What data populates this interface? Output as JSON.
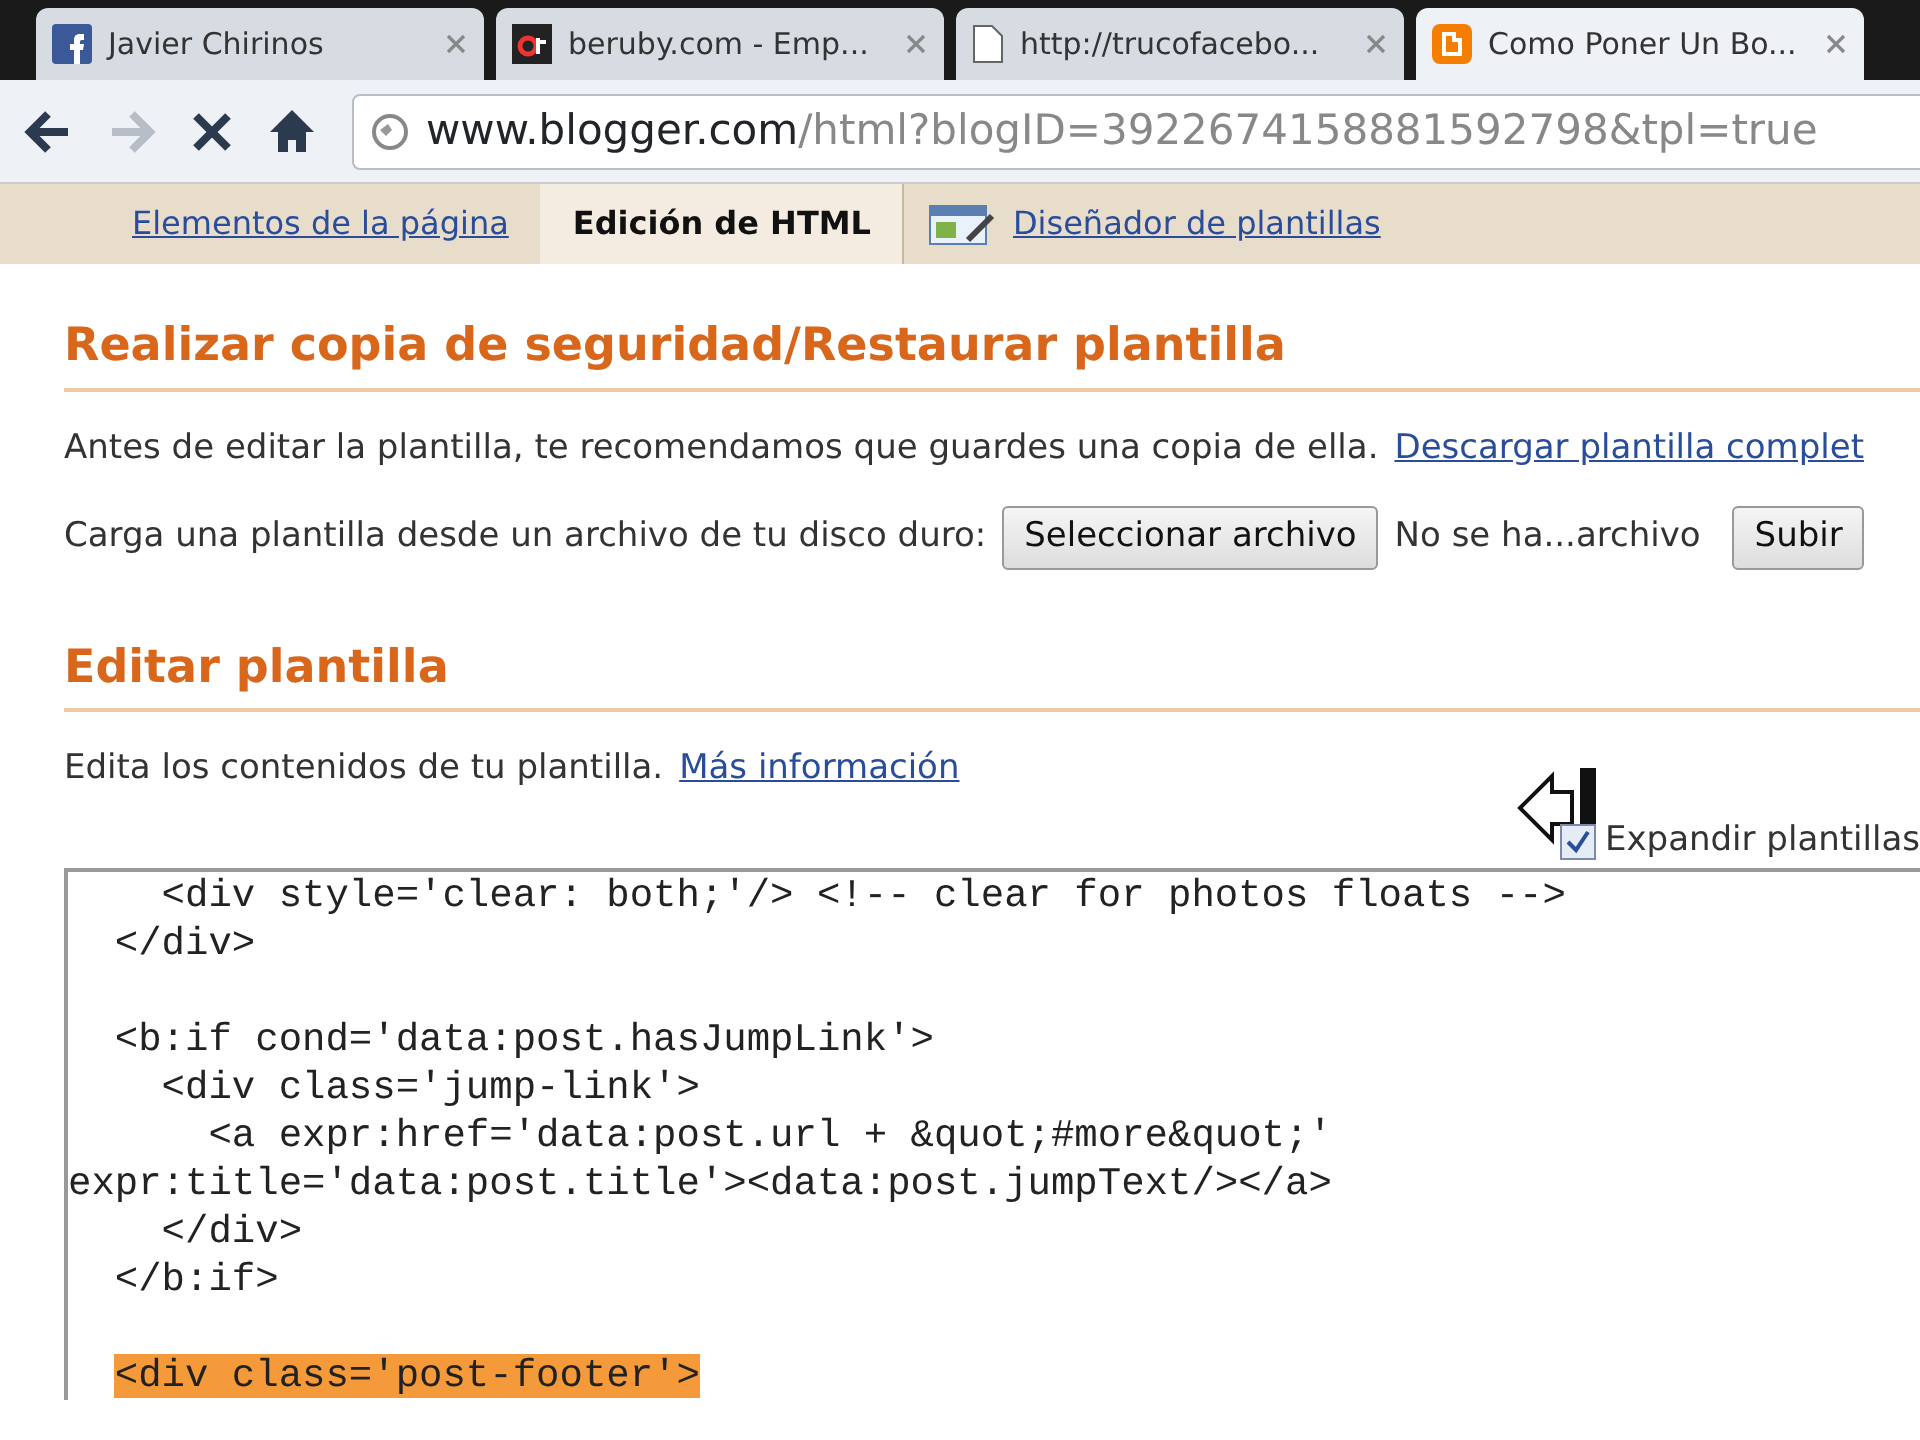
{
  "browser_tabs": [
    {
      "title": "Javier Chirinos",
      "kind": "facebook",
      "selected": false
    },
    {
      "title": "beruby.com - Emp...",
      "kind": "beruby",
      "selected": false
    },
    {
      "title": "http://trucofacebo...",
      "kind": "page",
      "selected": false
    },
    {
      "title": "Como Poner Un Bo...",
      "kind": "blogger",
      "selected": true
    }
  ],
  "address_bar": {
    "host": "www.blogger.com",
    "path": "/html?blogID=3922674158881592798&tpl=true"
  },
  "page_tabs": [
    {
      "label": "Elementos de la página",
      "selected": false,
      "kind": "link"
    },
    {
      "label": "Edición de HTML",
      "selected": true,
      "kind": "link"
    },
    {
      "label": "Diseñador de plantillas",
      "selected": false,
      "kind": "designer"
    }
  ],
  "backup_section": {
    "heading": "Realizar copia de seguridad/Restaurar plantilla",
    "intro": "Antes de editar la plantilla, te recomendamos que guardes una copia de ella.",
    "download_link": "Descargar plantilla complet",
    "upload_label": "Carga una plantilla desde un archivo de tu disco duro:",
    "choose_button": "Seleccionar archivo",
    "file_status": "No se ha...archivo",
    "upload_button": "Subir"
  },
  "edit_section": {
    "heading": "Editar plantilla",
    "intro": "Edita los contenidos de tu plantilla.",
    "more_link": "Más información",
    "expand_checkbox": {
      "label": "Expandir plantillas",
      "checked": true
    },
    "code_lines": [
      {
        "text": "    <div style='clear: both;'/> <!-- clear for photos floats -->",
        "highlighted": false
      },
      {
        "text": "  </div>",
        "highlighted": false
      },
      {
        "text": "  <b:if cond='data:post.hasJumpLink'>",
        "highlighted": false,
        "after_blank": true
      },
      {
        "text": "    <div class='jump-link'>",
        "highlighted": false
      },
      {
        "text": "      <a expr:href='data:post.url + &quot;#more&quot;'",
        "highlighted": false
      },
      {
        "text": "expr:title='data:post.title'><data:post.jumpText/></a>",
        "highlighted": false
      },
      {
        "text": "    </div>",
        "highlighted": false
      },
      {
        "text": "  </b:if>",
        "highlighted": false
      },
      {
        "text": "  <div class='post-footer'>",
        "highlighted": true,
        "after_blank": true
      }
    ]
  }
}
